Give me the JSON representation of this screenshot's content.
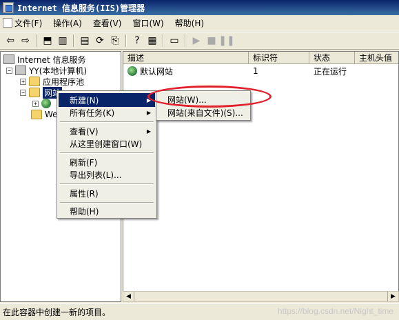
{
  "window": {
    "title": "Internet 信息服务(IIS)管理器"
  },
  "menubar": [
    {
      "label": "文件(F)"
    },
    {
      "label": "操作(A)"
    },
    {
      "label": "查看(V)"
    },
    {
      "label": "窗口(W)"
    },
    {
      "label": "帮助(H)"
    }
  ],
  "tree": {
    "root": "Internet 信息服务",
    "computer": "YY(本地计算机)",
    "app_pools": "应用程序池",
    "websites": "网站",
    "web_prefix": "Web"
  },
  "list": {
    "columns": [
      "描述",
      "标识符",
      "状态",
      "主机头值"
    ],
    "rows": [
      {
        "description": "默认网站",
        "id": "1",
        "status": "正在运行",
        "host": ""
      }
    ]
  },
  "context_menu": {
    "new": "新建(N)",
    "all_tasks": "所有任务(K)",
    "view": "查看(V)",
    "new_window": "从这里创建窗口(W)",
    "refresh": "刷新(F)",
    "export": "导出列表(L)...",
    "properties": "属性(R)",
    "help": "帮助(H)"
  },
  "submenu": {
    "website": "网站(W)...",
    "website_from_file": "网站(来自文件)(S)..."
  },
  "statusbar": {
    "text": "在此容器中创建一新的项目。"
  },
  "watermark": "https://blog.csdn.net/Night_time",
  "colors": {
    "selection": "#0a246a",
    "annotation": "#e0202a",
    "chrome": "#ece9d8"
  }
}
